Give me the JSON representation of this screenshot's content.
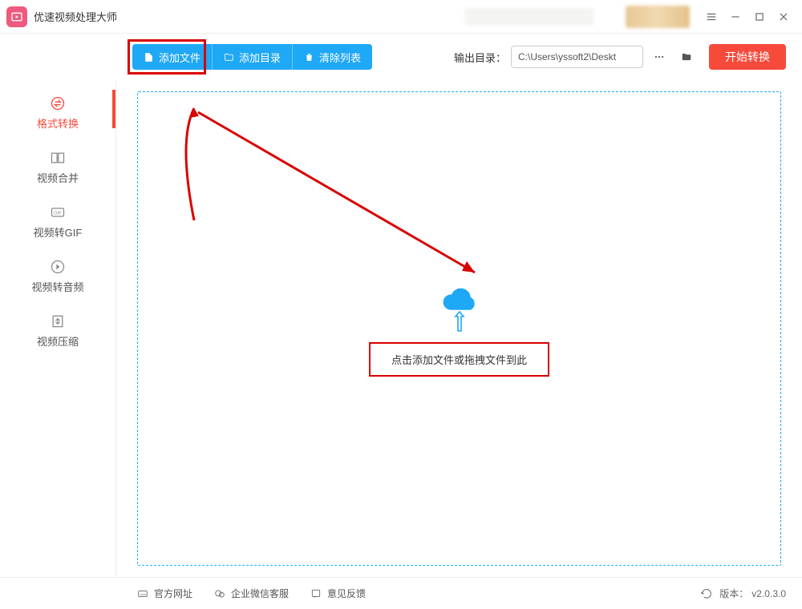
{
  "app": {
    "title": "优速视频处理大师"
  },
  "titlebar_icons": {
    "menu": "menu-icon",
    "min": "minimize-icon",
    "max": "maximize-icon",
    "close": "close-icon"
  },
  "toolbar": {
    "add_file": "添加文件",
    "add_dir": "添加目录",
    "clear_list": "清除列表",
    "output_label": "输出目录：",
    "output_path": "C:\\Users\\yssoft2\\Deskt",
    "start": "开始转换"
  },
  "sidebar": {
    "items": [
      {
        "label": "格式转换",
        "icon": "convert-icon",
        "active": true
      },
      {
        "label": "视频合并",
        "icon": "merge-icon",
        "active": false
      },
      {
        "label": "视频转GIF",
        "icon": "gif-icon",
        "active": false
      },
      {
        "label": "视频转音频",
        "icon": "audio-icon",
        "active": false
      },
      {
        "label": "视频压缩",
        "icon": "compress-icon",
        "active": false
      }
    ]
  },
  "dropzone": {
    "text": "点击添加文件或拖拽文件到此"
  },
  "footer": {
    "links": [
      {
        "label": "官方网址",
        "icon": "website-icon"
      },
      {
        "label": "企业微信客服",
        "icon": "wechat-icon"
      },
      {
        "label": "意见反馈",
        "icon": "feedback-icon"
      }
    ],
    "version_prefix": "版本：",
    "version": "v2.0.3.0"
  },
  "colors": {
    "accent_blue": "#1ea8f5",
    "accent_red": "#f74a3b",
    "annotation_red": "#d90000"
  }
}
